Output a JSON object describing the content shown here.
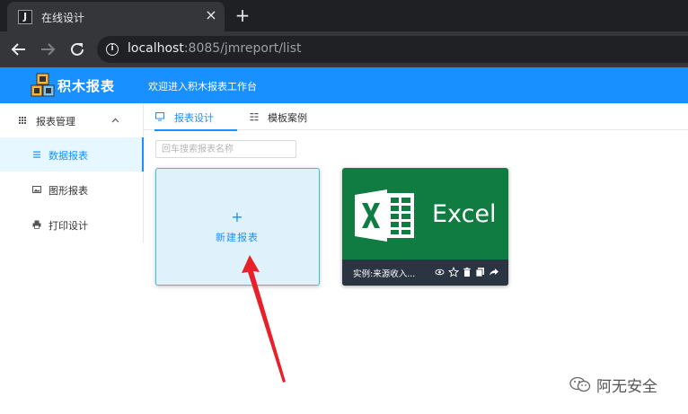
{
  "browser": {
    "tab": {
      "favicon": "J",
      "title": "在线设计",
      "close_icon": "×"
    },
    "new_tab_icon": "+",
    "url": {
      "host": "localhost",
      "rest": ":8085/jmreport/list"
    }
  },
  "header": {
    "logo_text": "积木报表",
    "welcome": "欢迎进入积木报表工作台"
  },
  "sidebar": {
    "group": {
      "label": "报表管理",
      "caret": "^"
    },
    "items": [
      {
        "label": "数据报表",
        "icon": "list-icon",
        "active": true
      },
      {
        "label": "图形报表",
        "icon": "image-icon",
        "active": false
      },
      {
        "label": "打印设计",
        "icon": "printer-icon",
        "active": false
      }
    ]
  },
  "tabs": [
    {
      "label": "报表设计",
      "icon": "monitor-icon",
      "active": true
    },
    {
      "label": "模板案例",
      "icon": "template-icon",
      "active": false
    }
  ],
  "search": {
    "placeholder": "回车搜索报表名称"
  },
  "cards": {
    "new": {
      "plus": "+",
      "label": "新建报表"
    },
    "excel": {
      "brand": "Excel",
      "name": "实例:来源收入...",
      "actions": [
        "eye-icon",
        "star-icon",
        "trash-icon",
        "copy-icon",
        "share-icon"
      ]
    }
  },
  "watermark": {
    "text": "阿无安全"
  },
  "colors": {
    "brand": "#1890ff",
    "excel_green": "#107c41",
    "arrow": "#e8202a"
  }
}
